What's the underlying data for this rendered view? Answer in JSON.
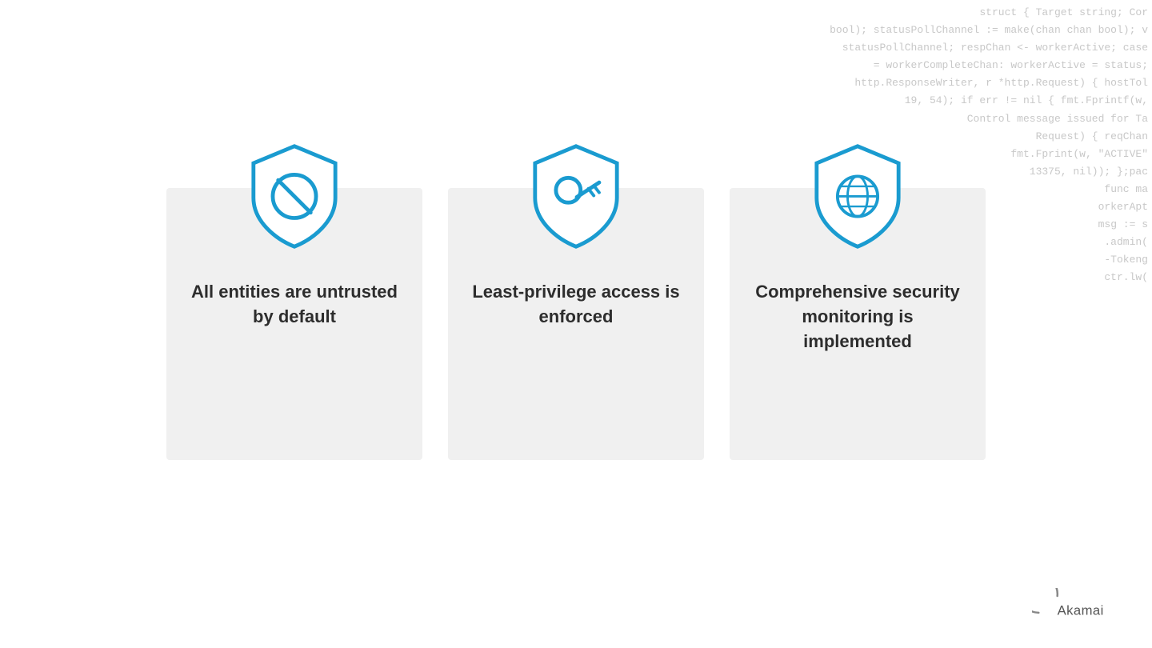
{
  "background": {
    "code_lines": [
      "struct { Target string; Cor",
      "bool); statusPollChannel := make(chan chan bool); v",
      "statusPollChannel; respChan <- workerActive; case",
      "= workerCompleteChan: workerActive = status;",
      "http.ResponseWriter, r *http.Request) { hostTol",
      "19, 54); if err != nil { fmt.Fprintf(w,",
      "Control message issued for Ta",
      "Request) { reqChan",
      "fmt.Fprint(w, \"ACTIVE\"",
      "13375, nil)); };pac",
      "func ma",
      "orkerApt",
      "msg := s",
      ".admin(",
      "-Tokeng",
      "ctr.lw("
    ]
  },
  "cards": [
    {
      "id": "untrusted",
      "label": "card-untrusted",
      "text": "All entities are untrusted by default",
      "icon": "ban-icon"
    },
    {
      "id": "least-privilege",
      "label": "card-least-privilege",
      "text": "Least-privilege access is enforced",
      "icon": "key-icon"
    },
    {
      "id": "monitoring",
      "label": "card-monitoring",
      "text": "Comprehensive security monitoring is implemented",
      "icon": "globe-icon"
    }
  ],
  "logo": {
    "name": "Akamai",
    "text": "Akamai"
  },
  "colors": {
    "accent": "#1a9bd0",
    "card_bg": "#efefef",
    "text_dark": "#2d2d2d",
    "code_color": "#c8c8c8"
  }
}
